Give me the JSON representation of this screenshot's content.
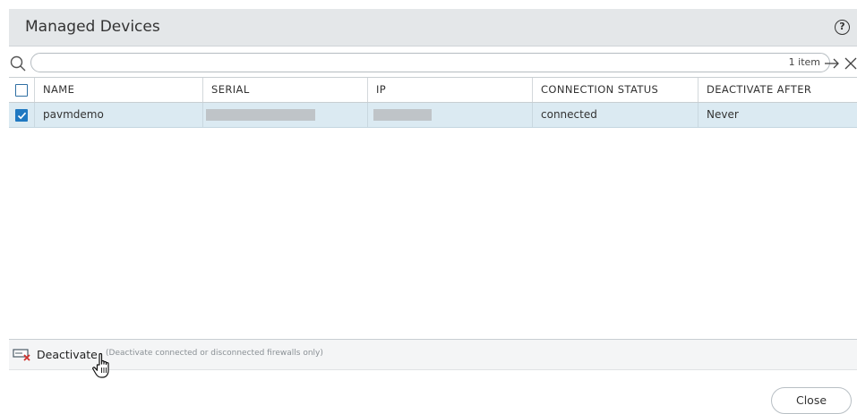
{
  "dialog": {
    "title": "Managed Devices",
    "help_icon": "?"
  },
  "search": {
    "value": "",
    "placeholder": "",
    "count": "1 item"
  },
  "table": {
    "columns": [
      "NAME",
      "SERIAL",
      "IP",
      "CONNECTION STATUS",
      "DEACTIVATE AFTER"
    ],
    "rows": [
      {
        "selected": true,
        "name": "pavmdemo",
        "serial": "",
        "ip": "",
        "connection_status": "connected",
        "deactivate_after": "Never"
      }
    ]
  },
  "footer": {
    "deactivate_label": "Deactivate",
    "deactivate_hint": "(Deactivate connected or disconnected firewalls only)"
  },
  "close_label": "Close",
  "colors": {
    "header_bg": "#e4e7e9",
    "selected_row_bg": "#dbeaf2",
    "checkbox_accent": "#1f78c1"
  },
  "icons": [
    "search-icon",
    "arrow-right-icon",
    "close-x-icon",
    "help-icon",
    "deactivate-icon",
    "hand-cursor-icon",
    "checkmark-icon"
  ]
}
